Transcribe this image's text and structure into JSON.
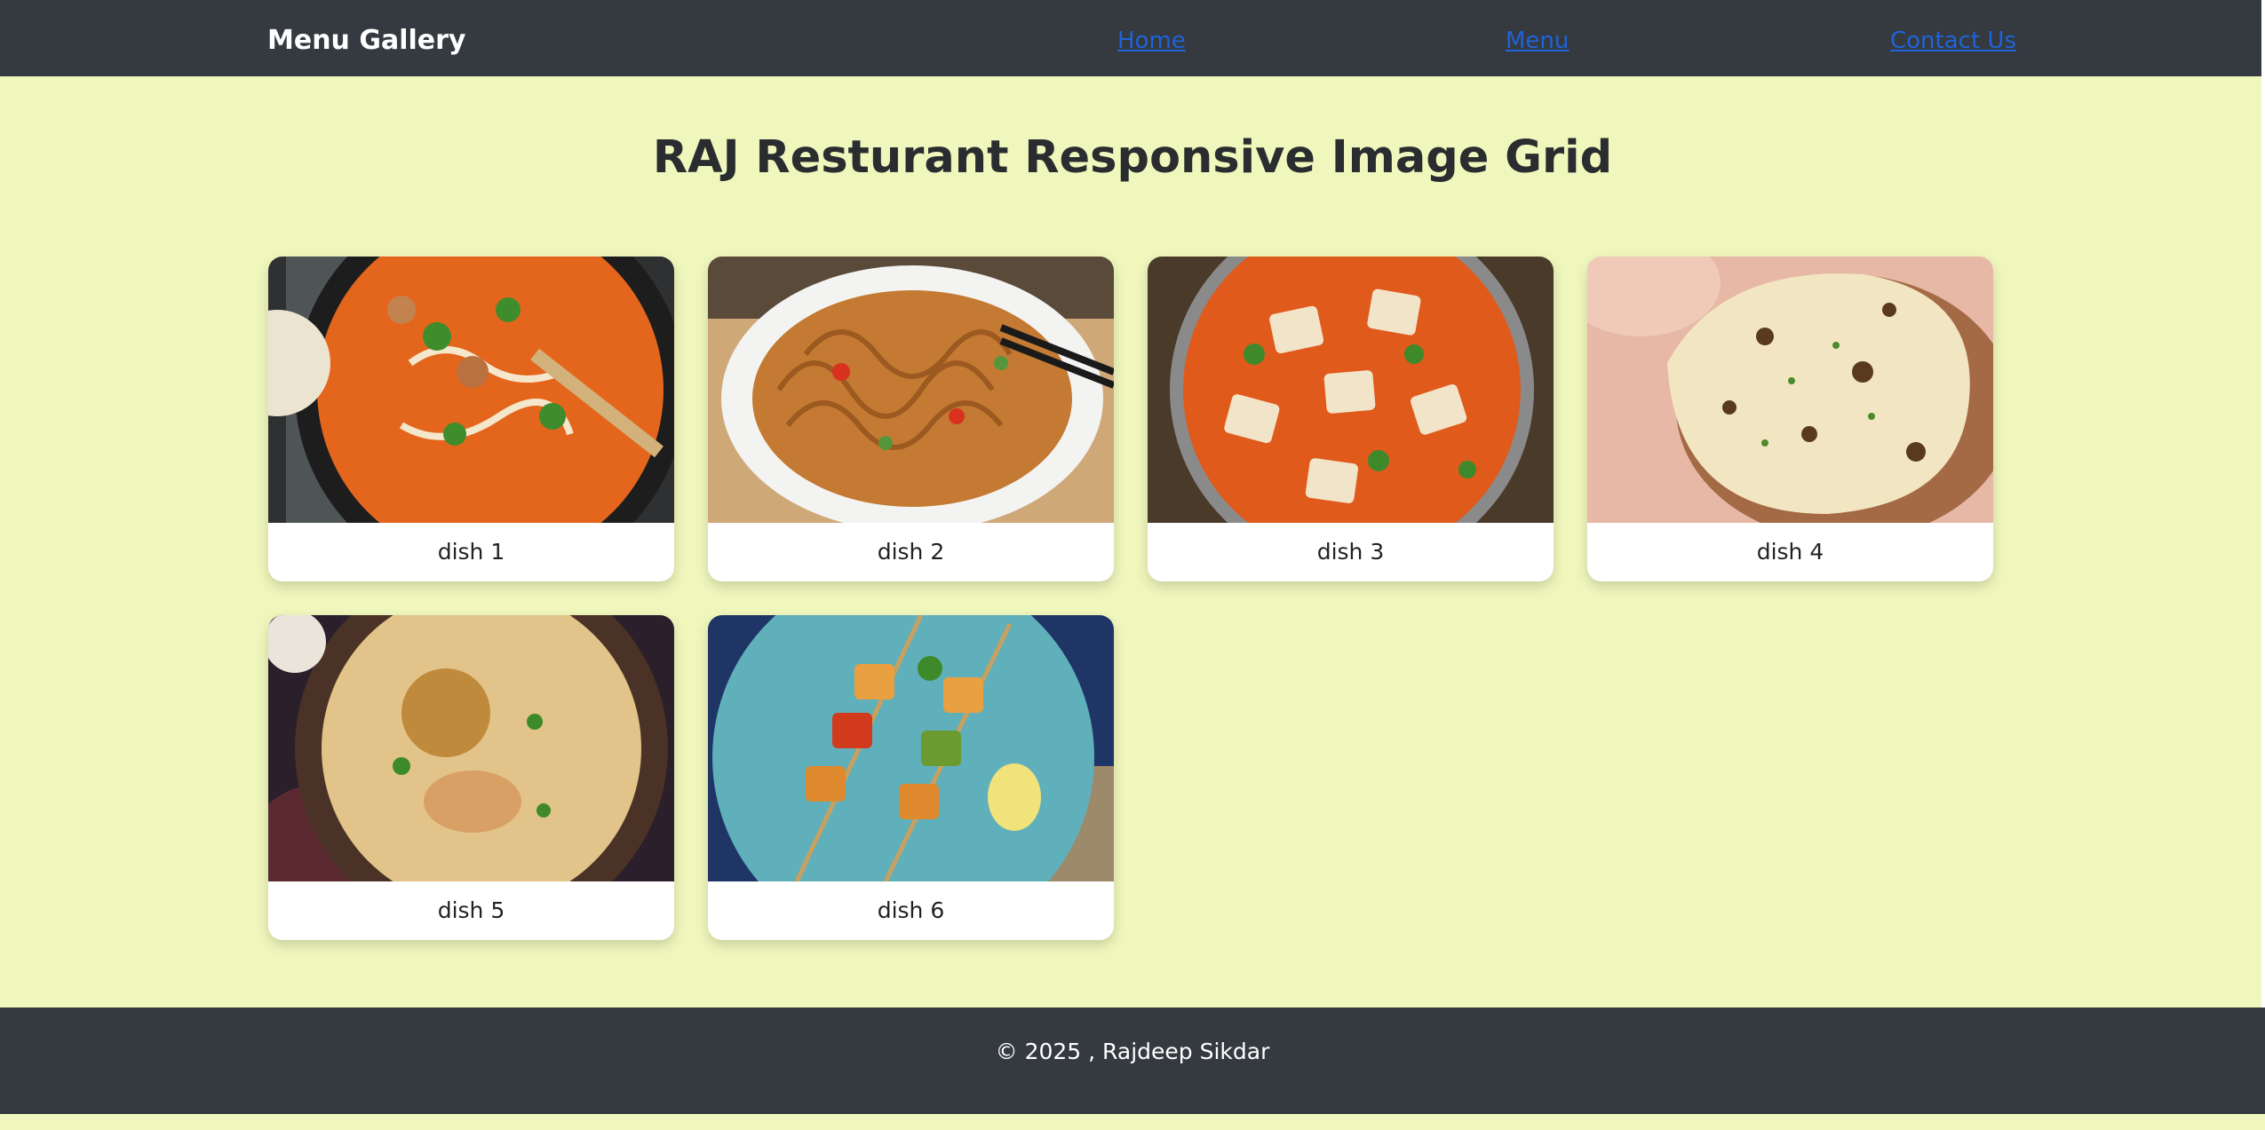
{
  "navbar": {
    "brand": "Menu Gallery",
    "links": [
      {
        "label": "Home"
      },
      {
        "label": "Menu"
      },
      {
        "label": "Contact Us"
      }
    ],
    "bg_color": "#343a40",
    "link_color": "#1f63d8"
  },
  "main": {
    "title": "RAJ Resturant Responsive Image Grid",
    "bg_color": "#f0f7bd",
    "dishes": [
      {
        "caption": "dish 1",
        "image": "butter-chicken-photo"
      },
      {
        "caption": "dish 2",
        "image": "noodles-photo"
      },
      {
        "caption": "dish 3",
        "image": "paneer-curry-photo"
      },
      {
        "caption": "dish 4",
        "image": "naan-photo"
      },
      {
        "caption": "dish 5",
        "image": "biryani-photo"
      },
      {
        "caption": "dish 6",
        "image": "paneer-tikka-photo"
      }
    ]
  },
  "footer": {
    "text": "© 2025 , Rajdeep Sikdar"
  }
}
